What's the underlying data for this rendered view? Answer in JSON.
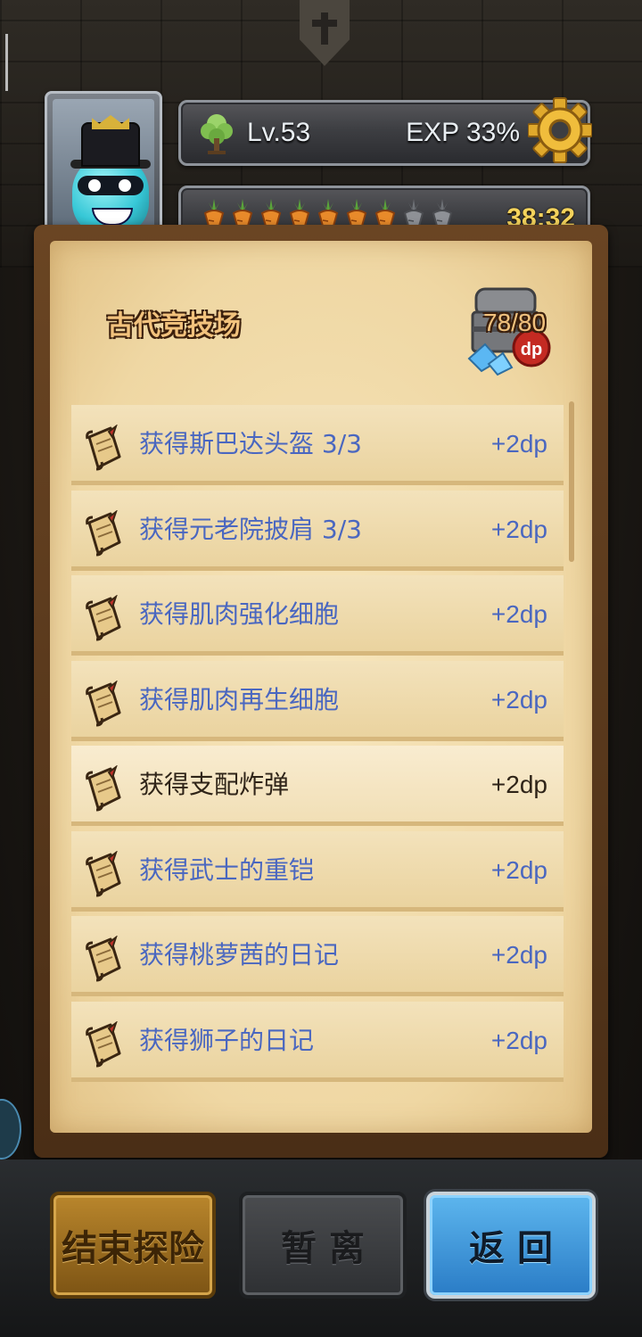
{
  "header": {
    "level": "Lv.53",
    "exp": "EXP 33%",
    "timer": "38:32",
    "carrots": {
      "full": 7,
      "total": 9
    }
  },
  "panel": {
    "title": "古代竞技场",
    "dp_count": "78/80",
    "items": [
      {
        "label": "获得斯巴达头盔 3/3",
        "value": "+2dp"
      },
      {
        "label": "获得元老院披肩 3/3",
        "value": "+2dp"
      },
      {
        "label": "获得肌肉强化细胞",
        "value": "+2dp"
      },
      {
        "label": "获得肌肉再生细胞",
        "value": "+2dp"
      },
      {
        "label": "获得支配炸弹",
        "value": "+2dp"
      },
      {
        "label": "获得武士的重铠",
        "value": "+2dp"
      },
      {
        "label": "获得桃萝茜的日记",
        "value": "+2dp"
      },
      {
        "label": "获得狮子的日记",
        "value": "+2dp"
      }
    ]
  },
  "buttons": {
    "end": "结束探险",
    "leave": "暂 离",
    "back": "返 回"
  },
  "colors": {
    "link_text": "#4a67c0",
    "active_text": "#2f2418",
    "timer": "#f4d35c",
    "back_button": "#3f99dc"
  }
}
